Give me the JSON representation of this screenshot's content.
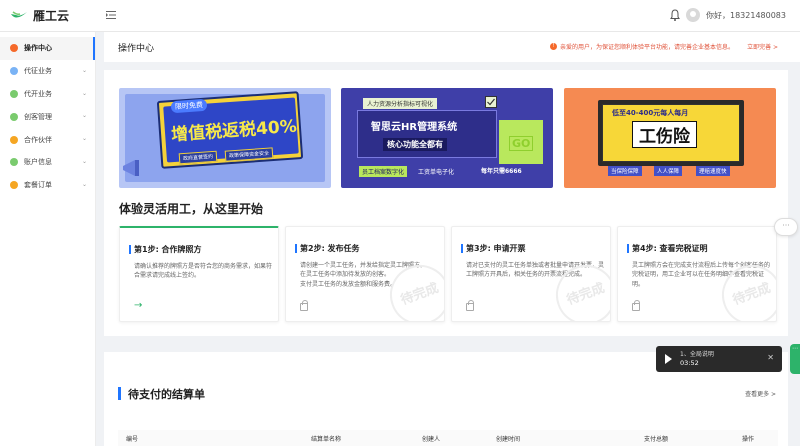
{
  "app": {
    "name": "雁工云"
  },
  "header": {
    "greeting": "你好，18321480083"
  },
  "sidebar": {
    "items": [
      {
        "label": "操作中心",
        "icon": "home-icon",
        "color": "#f5692a",
        "active": true
      },
      {
        "label": "代征业务",
        "icon": "tax-icon",
        "color": "#7ab3f5",
        "expandable": true
      },
      {
        "label": "代开业务",
        "icon": "invoice-icon",
        "color": "#7acb6e",
        "expandable": true
      },
      {
        "label": "创客管理",
        "icon": "users-icon",
        "color": "#7acb6e",
        "expandable": true
      },
      {
        "label": "合作伙伴",
        "icon": "partner-icon",
        "color": "#f5a623",
        "expandable": true
      },
      {
        "label": "账户信息",
        "icon": "account-icon",
        "color": "#7acb6e",
        "expandable": true
      },
      {
        "label": "套餐订单",
        "icon": "order-icon",
        "color": "#f5a623",
        "expandable": true
      }
    ]
  },
  "page": {
    "title": "操作中心",
    "notice": "亲爱的用户，为保证您顺利体验平台功能，请完善企业基本信息。",
    "notice_link": "立即完善 >"
  },
  "banners": [
    {
      "tag": "限时免费",
      "headline": "增值税返税40%",
      "sub1": "政府直营签约",
      "sub2": "政策保障资金安全"
    },
    {
      "top": "人力资源分析指标可视化",
      "headline": "智思云HR管理系统",
      "sub": "核心功能全都有",
      "tag1": "员工档案数字化",
      "tag2": "工资单电子化",
      "price": "每年只需6666"
    },
    {
      "top": "低至40-400元每人每月",
      "headline": "工伤险",
      "tags": [
        "当保险保障",
        "人人保障",
        "理赔速度快"
      ]
    }
  ],
  "steps_section": {
    "title": "体验灵活用工，从这里开始"
  },
  "steps": [
    {
      "title": "第1步: 合作牌照方",
      "desc": "请确认推荐的牌照方是否符合您的商务需求，如果符合需求请完成线上签约。",
      "done": true
    },
    {
      "title": "第2步: 发布任务",
      "desc": "请创建一个灵工任务，并发给指定灵工牌照方。\n在灵工任务中添加待发放的创客。\n支付灵工任务的发放金额和服务费。",
      "stamp": "待完成"
    },
    {
      "title": "第3步: 申请开票",
      "desc": "请对已支付的灵工任务单独或者批量申请开发票，灵工牌照方开具后，相关任务的开票流程完成。",
      "stamp": "待完成"
    },
    {
      "title": "第4步: 查看完税证明",
      "desc": "灵工牌照方会在完成支付流程后上传每个创客任务的完税证明，用工企业可以在任务明细中查看完税证明。",
      "stamp": "待完成"
    }
  ],
  "settlement": {
    "title": "待支付的结算单",
    "more": "查看更多 >",
    "columns": [
      "编号",
      "结算单名称",
      "创建人",
      "创建时间",
      "支付总额",
      "操作"
    ]
  },
  "player": {
    "title": "1、全局说明",
    "time": "03:52"
  },
  "chat": {
    "label": "···"
  }
}
